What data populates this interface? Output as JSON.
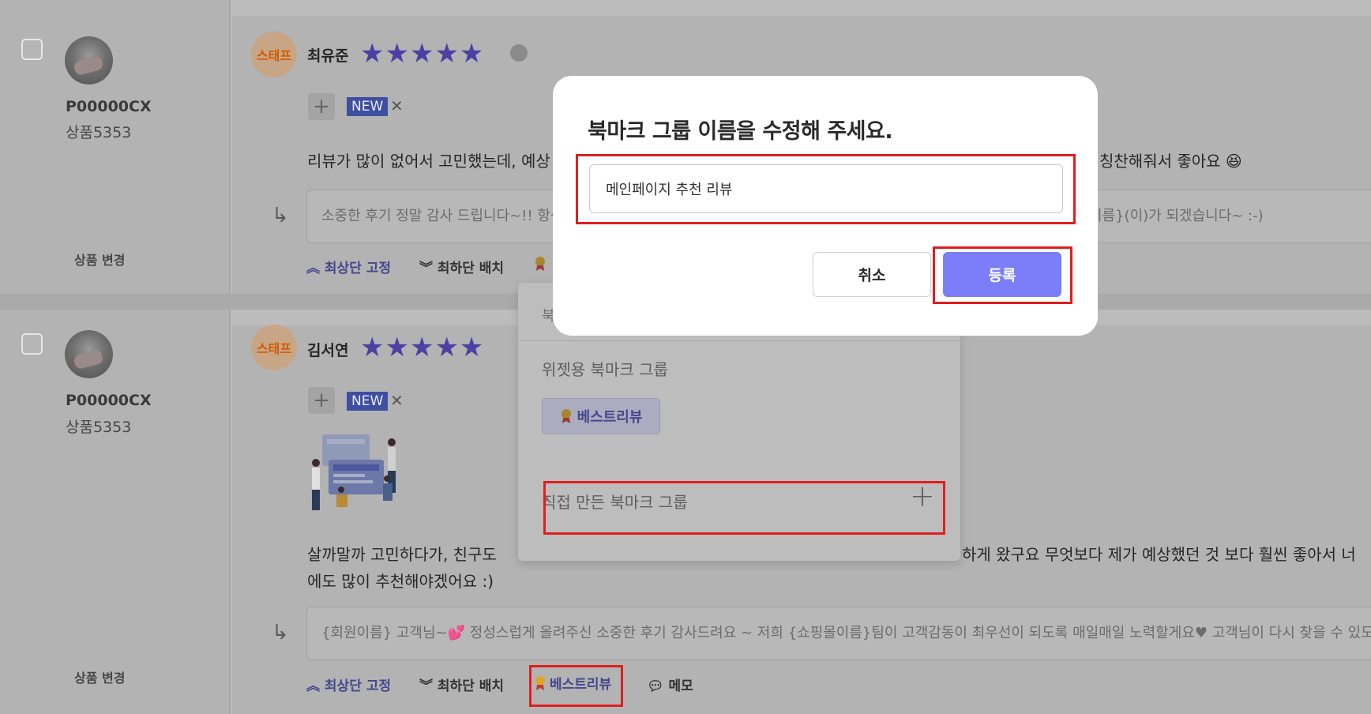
{
  "reviews": [
    {
      "product_code": "P00000CX",
      "product_name": "상품5353",
      "change_label": "상품 변경",
      "staff_label": "스태프",
      "author": "최유준",
      "stars": "★★★★★",
      "new_label": "NEW",
      "text_left": "리뷰가 많이 없어서 고민했는데, 예상",
      "text_right": "칭찬해줘서 좋아요 😆",
      "reply_left": "소중한 후기 정말 감사 드립니다~!! 항상",
      "reply_right": "이름}(이)가 되겠습니다~ :-)",
      "actions": {
        "top": "최상단 고정",
        "bottom": "최하단 배치"
      }
    },
    {
      "product_code": "P00000CX",
      "product_name": "상품5353",
      "change_label": "상품 변경",
      "staff_label": "스태프",
      "author": "김서연",
      "stars": "★★★★★",
      "new_label": "NEW",
      "text_line1_left": "살까말까 고민하다가, 친구도 ",
      "text_line1_right": "하게 왔구요 무엇보다 제가 예상했던 것 보다 훨씬 좋아서 너",
      "text_line2": "에도 많이 추천해야겠어요 :)",
      "reply": "{회원이름} 고객님~💕 정성스럽게 올려주신 소중한 후기 감사드려요 ~ 저희 {쇼핑몰이름}팀이 고객감동이 최우선이 되도록 매일매일 노력할게요♥ 고객님이 다시 찾을 수 있도록",
      "actions": {
        "top": "최상단 고정",
        "bottom": "최하단 배치",
        "best": "베스트리뷰",
        "memo": "메모"
      }
    }
  ],
  "dropdown": {
    "header_text": "북",
    "widget_group_title": "위젯용 북마크 그룹",
    "chip_label": "베스트리뷰",
    "custom_group_title": "직접 만든 북마크 그룹",
    "add_icon": "+"
  },
  "modal": {
    "title": "북마크 그룹 이름을 수정해 주세요.",
    "input_value": "메인페이지 추천 리뷰",
    "cancel_label": "취소",
    "submit_label": "등록"
  },
  "colors": {
    "accent": "#7b7ef8",
    "highlight": "#e01e1e",
    "staff": "#d25a00"
  }
}
